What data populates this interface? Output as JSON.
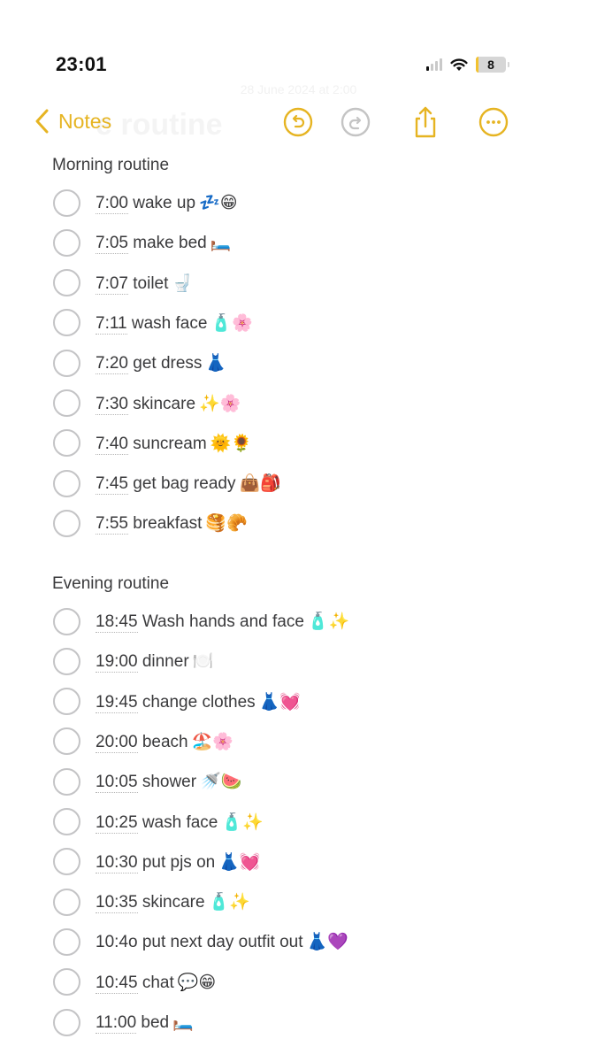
{
  "status_bar": {
    "time": "23:01",
    "battery_level": "8",
    "signal_bars_active": 1,
    "signal_bars_total": 4
  },
  "background_ghost": {
    "date": "28 June 2024 at 2:00",
    "title": "e routine"
  },
  "nav": {
    "back_label": "Notes",
    "icons": [
      "undo-icon",
      "redo-icon",
      "share-icon",
      "more-icon"
    ],
    "accent_color": "#e6b422",
    "disabled_color": "#c4c4c4"
  },
  "sections": [
    {
      "heading": "Morning routine",
      "items": [
        {
          "time": "7:00",
          "text": " wake up",
          "emoji": "💤😁",
          "time_linked": true
        },
        {
          "time": "7:05",
          "text": " make bed",
          "emoji": "🛏️",
          "time_linked": true
        },
        {
          "time": "7:07",
          "text": " toilet",
          "emoji": "🚽",
          "time_linked": true
        },
        {
          "time": "7:11",
          "text": " wash face",
          "emoji": "🧴🌸",
          "time_linked": true
        },
        {
          "time": "7:20",
          "text": " get dress",
          "emoji": "👗",
          "time_linked": true
        },
        {
          "time": "7:30",
          "text": " skincare",
          "emoji": "✨🌸",
          "time_linked": true
        },
        {
          "time": "7:40",
          "text": " suncream",
          "emoji": "🌞🌻",
          "time_linked": true
        },
        {
          "time": "7:45",
          "text": " get bag ready",
          "emoji": "👜🎒",
          "time_linked": true
        },
        {
          "time": "7:55",
          "text": " breakfast",
          "emoji": "🥞🥐",
          "time_linked": true
        }
      ]
    },
    {
      "heading": "Evening routine",
      "items": [
        {
          "time": "18:45",
          "text": " Wash hands and face",
          "emoji": "🧴✨",
          "time_linked": true
        },
        {
          "time": "19:00",
          "text": " dinner",
          "emoji": "🍽️",
          "time_linked": true
        },
        {
          "time": "19:45",
          "text": " change clothes",
          "emoji": "👗💓",
          "time_linked": true
        },
        {
          "time": "20:00",
          "text": " beach",
          "emoji": "🏖️🌸",
          "time_linked": true
        },
        {
          "time": "10:05",
          "text": " shower",
          "emoji": "🚿🍉",
          "time_linked": true
        },
        {
          "time": "10:25",
          "text": " wash face",
          "emoji": "🧴✨",
          "time_linked": true
        },
        {
          "time": "10:30",
          "text": " put pjs on",
          "emoji": "👗💓",
          "time_linked": true
        },
        {
          "time": "10:35",
          "text": " skincare",
          "emoji": "🧴✨",
          "time_linked": true
        },
        {
          "time": "10:4o",
          "text": " put next day outfit out",
          "emoji": "👗💜",
          "time_linked": false
        },
        {
          "time": "10:45",
          "text": " chat",
          "emoji": "💬😁",
          "time_linked": true
        },
        {
          "time": "11:00",
          "text": " bed",
          "emoji": "🛏️",
          "time_linked": true
        }
      ]
    }
  ]
}
